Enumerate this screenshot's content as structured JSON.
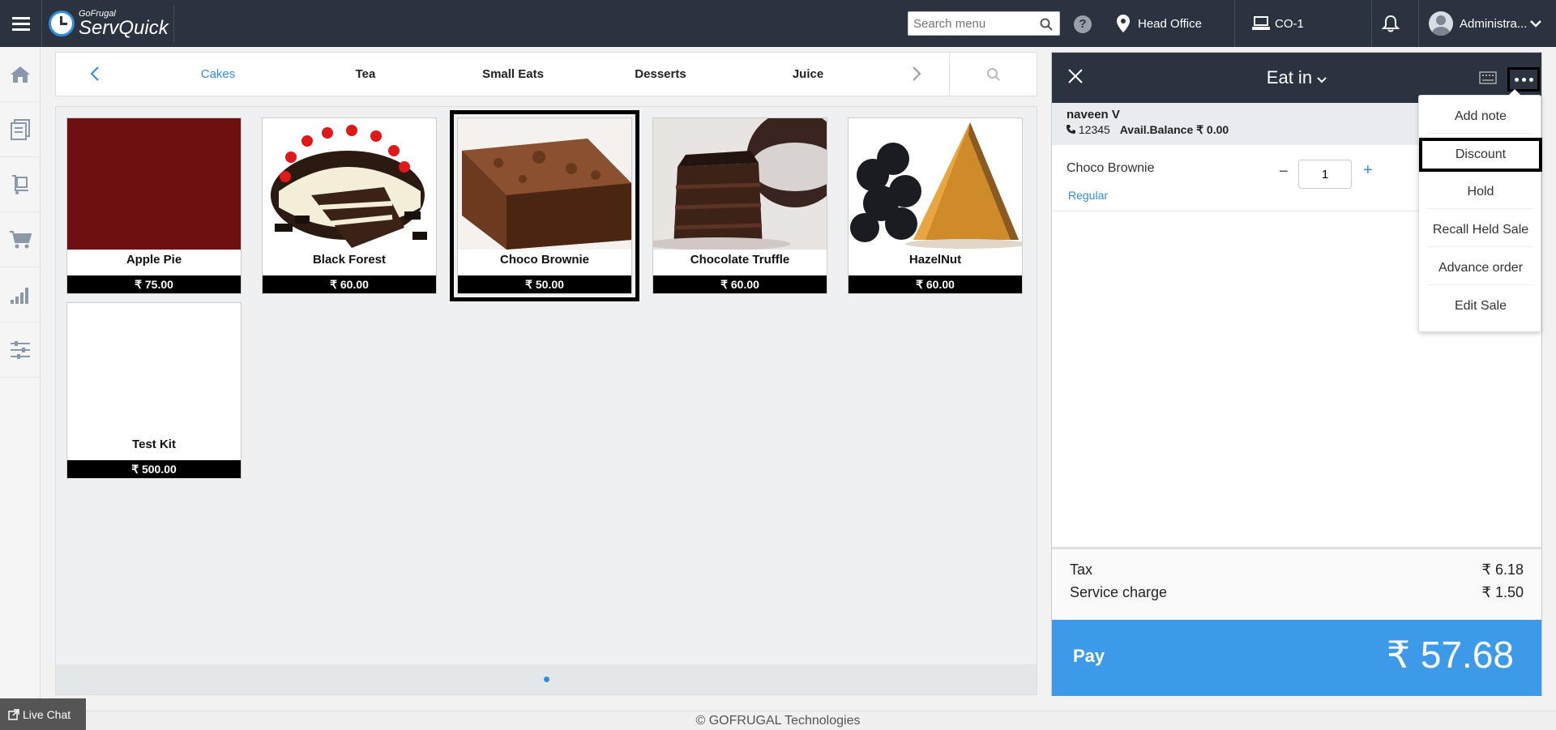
{
  "app": {
    "brand_small": "GoFrugal",
    "brand_big": "ServQuick"
  },
  "header": {
    "search_placeholder": "Search menu",
    "help": "?",
    "location": "Head Office",
    "terminal": "CO-1",
    "user": "Administra..."
  },
  "categories": [
    "Cakes",
    "Tea",
    "Small Eats",
    "Desserts",
    "Juice"
  ],
  "active_category": "Cakes",
  "products": [
    {
      "name": "Apple Pie",
      "price": "₹ 75.00"
    },
    {
      "name": "Black Forest",
      "price": "₹ 60.00"
    },
    {
      "name": "Choco Brownie",
      "price": "₹ 50.00"
    },
    {
      "name": "Chocolate Truffle",
      "price": "₹ 60.00"
    },
    {
      "name": "HazelNut",
      "price": "₹ 60.00"
    },
    {
      "name": "Test Kit",
      "price": "₹ 500.00"
    }
  ],
  "order": {
    "title": "Eat in",
    "customer_name": "naveen V",
    "customer_phone": "12345",
    "balance": "Avail.Balance ₹ 0.00",
    "item_name": "Choco Brownie",
    "item_variant": "Regular",
    "item_qty": "1",
    "tax_label": "Tax",
    "tax_value": "₹ 6.18",
    "service_label": "Service charge",
    "service_value": "₹ 1.50",
    "pay_label": "Pay",
    "pay_amount": "₹ 57.68"
  },
  "menu": [
    "Add note",
    "Discount",
    "Hold",
    "Recall Held Sale",
    "Advance order",
    "Edit Sale"
  ],
  "footer": "© GOFRUGAL Technologies",
  "live_chat": "Live Chat",
  "colors": {
    "accent": "#2e8de0",
    "header_bg": "#2b3340",
    "pay_bg": "#3d9ae8"
  }
}
